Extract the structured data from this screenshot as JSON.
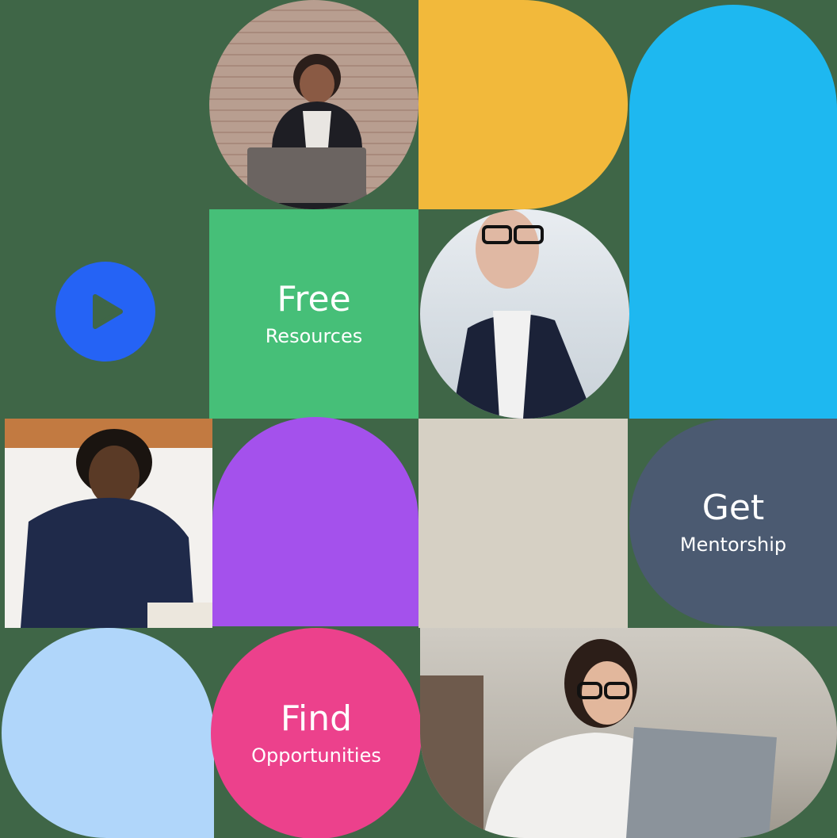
{
  "tiles": {
    "resources": {
      "title": "Free",
      "subtitle": "Resources"
    },
    "mentorship": {
      "title": "Get",
      "subtitle": "Mentorship"
    },
    "opportunities": {
      "title": "Find",
      "subtitle": "Opportunities"
    }
  },
  "icons": {
    "play": "play-icon"
  },
  "colors": {
    "background": "#3f6647",
    "yellow": "#f2b93b",
    "sky_blue": "#1eb8f0",
    "play_blue": "#2563f5",
    "green": "#46bf78",
    "purple": "#a451ec",
    "beige": "#d6d0c4",
    "slate": "#4b5a71",
    "light_blue": "#b0d6fa",
    "pink": "#ec418c"
  }
}
